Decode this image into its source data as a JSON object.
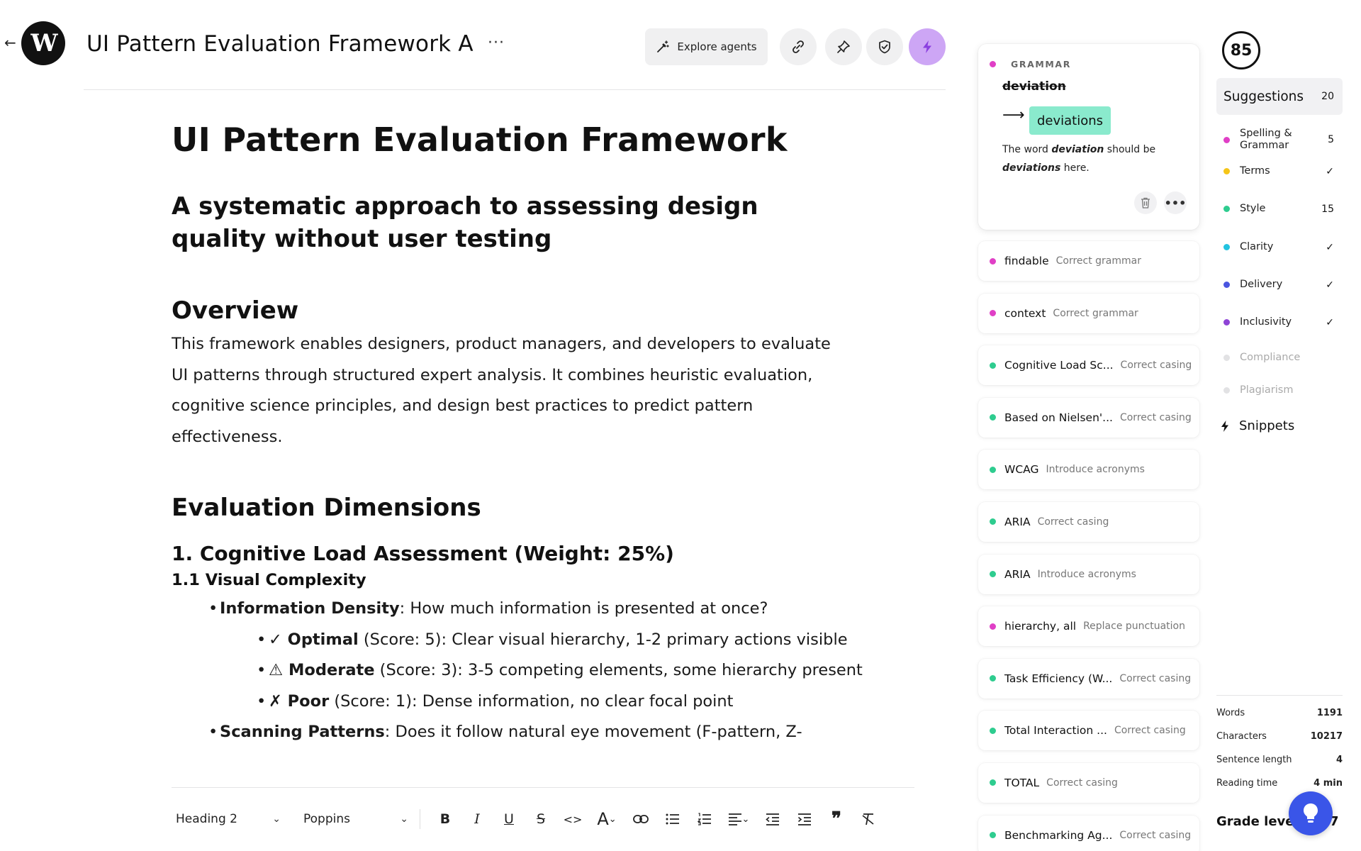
{
  "header": {
    "logo_letter": "W",
    "title": "UI Pattern Evaluation Framework A",
    "more_label": "···",
    "explore_label": "Explore agents"
  },
  "document": {
    "title": "UI Pattern Evaluation Framework",
    "subtitle": "A systematic approach to assessing design quality without user testing",
    "overview_heading": "Overview",
    "overview_text": "This framework enables designers, product managers, and developers to evaluate UI patterns through structured expert analysis. It combines heuristic evaluation, cognitive science principles, and design best practices to predict pattern effectiveness.",
    "dims_heading": "Evaluation Dimensions",
    "section1_heading": "1. Cognitive Load Assessment (Weight: 25%)",
    "subsection1_heading": "1.1 Visual Complexity",
    "items": [
      {
        "level": 1,
        "bullet": "•",
        "bold": "Information Density",
        "text": ": How much information is presented at once?"
      },
      {
        "level": 2,
        "bullet": "•",
        "bold": "✓ Optimal",
        "text": " (Score: 5): Clear visual hierarchy, 1-2 primary actions visible"
      },
      {
        "level": 2,
        "bullet": "•",
        "bold": "⚠ Moderate",
        "text": " (Score: 3): 3-5 competing elements, some hierarchy present"
      },
      {
        "level": 2,
        "bullet": "•",
        "bold": "✗ Poor",
        "text": " (Score: 1): Dense information, no clear focal point"
      },
      {
        "level": 1,
        "bullet": "•",
        "bold": "Scanning Patterns",
        "text": ": Does it follow natural eye movement (F-pattern, Z-"
      }
    ]
  },
  "toolbar": {
    "style_select": "Heading 2",
    "font_select": "Poppins",
    "buttons": [
      "B",
      "I",
      "U",
      "S",
      "<>",
      "A"
    ]
  },
  "grammar_card": {
    "category": "GRAMMAR",
    "original": "deviation",
    "replacement": "deviations",
    "desc_pre": "The word ",
    "desc_word1": "deviation",
    "desc_mid": " should be ",
    "desc_word2": "deviations",
    "desc_post": " here.",
    "dot_color": "#e03fc6"
  },
  "suggestions": [
    {
      "text": "findable",
      "action": "Correct grammar",
      "color": "#e03fc6"
    },
    {
      "text": "context",
      "action": "Correct grammar",
      "color": "#e03fc6"
    },
    {
      "text": "Cognitive Load Sc...",
      "action": "Correct casing",
      "color": "#2ecc8f"
    },
    {
      "text": "Based on Nielsen'...",
      "action": "Correct casing",
      "color": "#2ecc8f"
    },
    {
      "text": "WCAG",
      "action": "Introduce acronyms",
      "color": "#2ecc8f"
    },
    {
      "text": "ARIA",
      "action": "Correct casing",
      "color": "#2ecc8f"
    },
    {
      "text": "ARIA",
      "action": "Introduce acronyms",
      "color": "#2ecc8f"
    },
    {
      "text": "hierarchy, all",
      "action": "Replace punctuation",
      "color": "#e03fc6"
    },
    {
      "text": "Task Efficiency (W...",
      "action": "Correct casing",
      "color": "#2ecc8f"
    },
    {
      "text": "Total Interaction ...",
      "action": "Correct casing",
      "color": "#2ecc8f"
    },
    {
      "text": "TOTAL",
      "action": "Correct casing",
      "color": "#2ecc8f"
    },
    {
      "text": "Benchmarking Ag...",
      "action": "Correct casing",
      "color": "#2ecc8f"
    }
  ],
  "sidebar": {
    "score": "85",
    "suggestions_label": "Suggestions",
    "suggestions_count": "20",
    "categories": [
      {
        "label": "Spelling & Grammar",
        "count": "5",
        "color": "#e03fc6",
        "faded": false
      },
      {
        "label": "Terms",
        "count": "✓",
        "color": "#f5c518",
        "faded": false
      },
      {
        "label": "Style",
        "count": "15",
        "color": "#2ecc8f",
        "faded": false
      },
      {
        "label": "Clarity",
        "count": "✓",
        "color": "#22c3e0",
        "faded": false
      },
      {
        "label": "Delivery",
        "count": "✓",
        "color": "#4a55e0",
        "faded": false
      },
      {
        "label": "Inclusivity",
        "count": "✓",
        "color": "#8e44d6",
        "faded": false
      },
      {
        "label": "Compliance",
        "count": "",
        "color": "#e2e2e4",
        "faded": true
      },
      {
        "label": "Plagiarism",
        "count": "",
        "color": "#e2e2e4",
        "faded": true
      }
    ],
    "snippets_label": "Snippets",
    "stats": [
      {
        "label": "Words",
        "value": "1191"
      },
      {
        "label": "Characters",
        "value": "10217"
      },
      {
        "label": "Sentence length",
        "value": "4"
      },
      {
        "label": "Reading time",
        "value": "4 min"
      }
    ],
    "grade_label": "Grade level",
    "grade_value": "7"
  }
}
